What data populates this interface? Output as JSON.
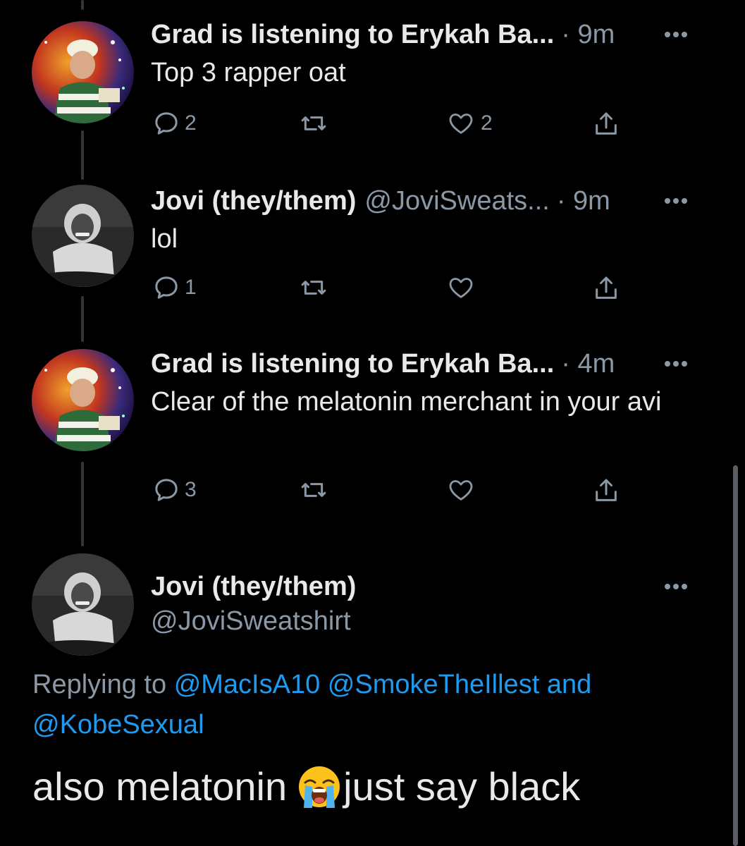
{
  "tweets": [
    {
      "name": "Grad is listening to Erykah Ba...",
      "handle": "",
      "time": "· 9m",
      "text": "Top 3 rapper oat",
      "replies": "2",
      "likes": "2"
    },
    {
      "name": "Jovi (they/them)",
      "handle": "@JoviSweats...",
      "time": "· 9m",
      "text": "lol",
      "replies": "1",
      "likes": ""
    },
    {
      "name": "Grad is listening to Erykah Ba...",
      "handle": "",
      "time": "· 4m",
      "text": "Clear of the melatonin merchant in your avi",
      "replies": "3",
      "likes": ""
    }
  ],
  "focused": {
    "name": "Jovi (they/them)",
    "handle": "@JoviSweatshirt",
    "replying_prefix": "Replying to",
    "mention_1": "@MacIsA10",
    "mention_2": "@SmokeTheIllest",
    "and_word": "and",
    "mention_3": "@KobeSexual",
    "text_before_emoji": "also melatonin",
    "text_after_emoji": "just say black",
    "emoji": "loudly-crying-face"
  },
  "colors": {
    "background": "#000000",
    "text": "#e7e9ea",
    "muted": "#8b98a5",
    "link": "#1d9bf0"
  }
}
